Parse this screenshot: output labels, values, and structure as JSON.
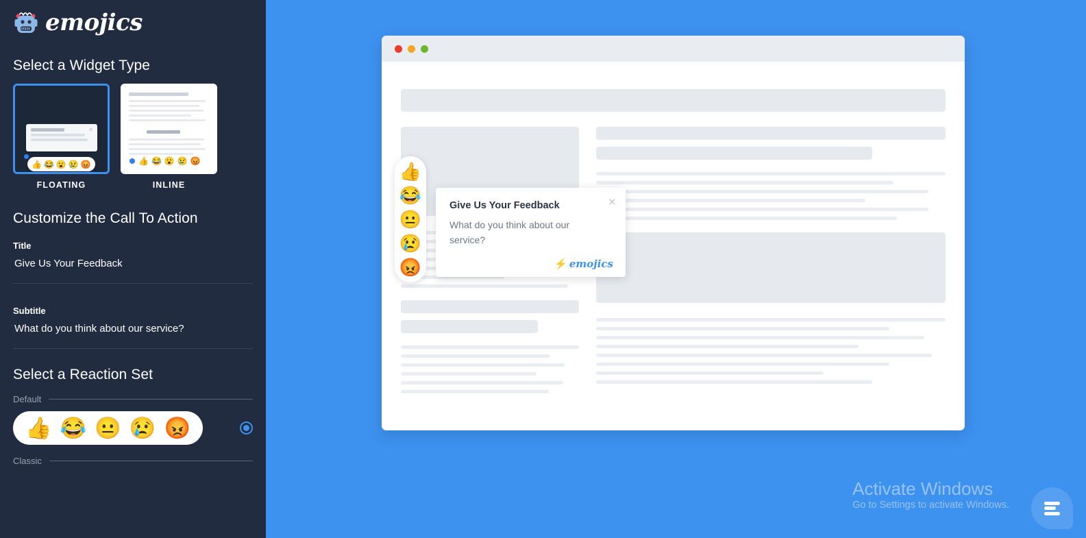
{
  "brand": {
    "name": "emojics",
    "logo_icon": "robot-head-icon"
  },
  "sidebar": {
    "widget_type": {
      "heading": "Select a Widget Type",
      "options": [
        {
          "label": "FLOATING",
          "selected": true
        },
        {
          "label": "INLINE",
          "selected": false
        }
      ]
    },
    "call_to_action": {
      "heading": "Customize the Call To Action",
      "title_label": "Title",
      "title_value": "Give Us Your Feedback",
      "subtitle_label": "Subtitle",
      "subtitle_value": "What do you think about our service?"
    },
    "reaction_set": {
      "heading": "Select a Reaction Set",
      "sets": [
        {
          "name": "Default",
          "selected": true,
          "emojis": [
            "👍",
            "😂",
            "😐",
            "😢",
            "😡"
          ]
        },
        {
          "name": "Classic",
          "selected": false,
          "emojis": []
        }
      ]
    }
  },
  "preview": {
    "window_dots": [
      "#ec3b2a",
      "#f5a623",
      "#6cb52d"
    ],
    "rail_emojis": [
      "👍",
      "😂",
      "😐",
      "😢",
      "😡"
    ],
    "popup": {
      "title": "Give Us Your Feedback",
      "subtitle": "What do you think about our service?",
      "close_label": "×",
      "brand_bolt": "⚡",
      "brand_name": "emojics"
    },
    "fab_icon": "menu-lines-icon"
  },
  "watermark": {
    "title": "Activate Windows",
    "subtitle": "Go to Settings to activate Windows."
  },
  "colors": {
    "sidebar_bg": "#212c40",
    "stage_bg": "#3d91ef",
    "accent": "#3d91ef",
    "skeleton": "#e6eaef"
  }
}
